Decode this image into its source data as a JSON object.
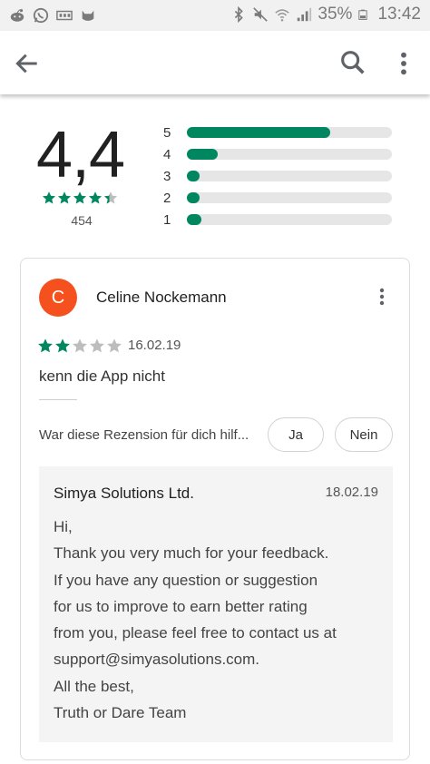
{
  "status_bar": {
    "battery": "35%",
    "time": "13:42",
    "left_icons": [
      "reddit-icon",
      "whatsapp-icon",
      "sim-icon",
      "cat-icon"
    ],
    "right_icons": [
      "bluetooth-icon",
      "mute-icon",
      "wifi-icon",
      "signal-icon",
      "battery-icon"
    ]
  },
  "app_bar": {
    "icons": [
      "back-arrow-icon",
      "search-icon",
      "more-vert-icon"
    ]
  },
  "summary": {
    "average": "4,4",
    "rating_value": 4.4,
    "count": "454",
    "histogram": [
      {
        "label": "5",
        "fraction": 0.7
      },
      {
        "label": "4",
        "fraction": 0.15
      },
      {
        "label": "3",
        "fraction": 0.06
      },
      {
        "label": "2",
        "fraction": 0.05
      },
      {
        "label": "1",
        "fraction": 0.07
      }
    ]
  },
  "review": {
    "avatar_letter": "C",
    "avatar_color": "#f4511e",
    "name": "Celine Nockemann",
    "stars": 2,
    "date": "16.02.19",
    "text": "kenn die App nicht",
    "helpful_question": "War diese Rezension für dich hilf...",
    "yes_label": "Ja",
    "no_label": "Nein",
    "developer_reply": {
      "name": "Simya Solutions Ltd.",
      "date": "18.02.19",
      "lines": [
        "Hi,",
        "Thank you very much for your feedback.",
        "If you have any question or suggestion",
        "for us to improve to earn better rating",
        "from you, please feel free to contact us at",
        "support@simyasolutions.com.",
        "All the best,",
        "Truth or Dare Team"
      ]
    }
  },
  "colors": {
    "accent_green": "#01875f",
    "star_gray": "#bdbdbd",
    "track_gray": "#e6e6e6"
  }
}
